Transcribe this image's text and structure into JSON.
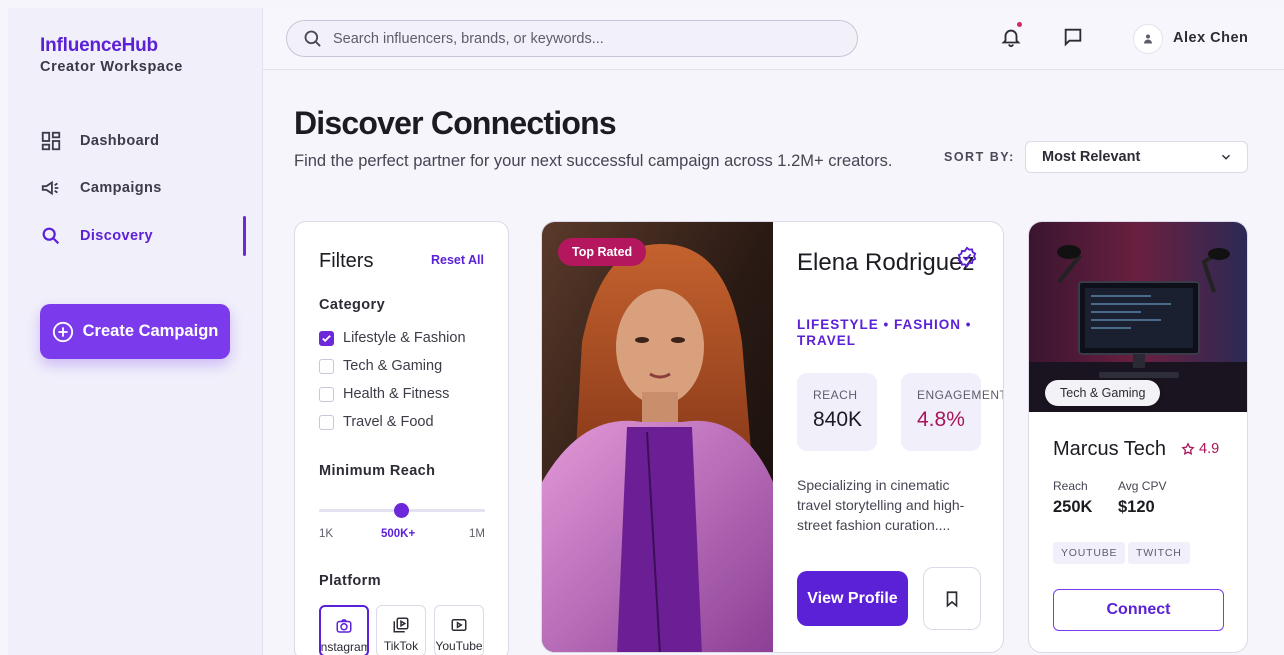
{
  "brand": {
    "name": "InfluenceHub",
    "subtitle": "Creator Workspace"
  },
  "nav": [
    {
      "label": "Dashboard",
      "icon": "dashboard-icon"
    },
    {
      "label": "Campaigns",
      "icon": "megaphone-icon"
    },
    {
      "label": "Discovery",
      "icon": "search-icon",
      "active": true
    }
  ],
  "create_button": "Create Campaign",
  "search": {
    "placeholder": "Search influencers, brands, or keywords..."
  },
  "user": {
    "name": "Alex Chen"
  },
  "page": {
    "title": "Discover Connections",
    "subtitle": "Find the perfect partner for your next successful campaign across 1.2M+ creators.",
    "sort_label": "SORT BY:",
    "sort_value": "Most Relevant"
  },
  "filters": {
    "title": "Filters",
    "reset": "Reset All",
    "category_label": "Category",
    "categories": [
      {
        "label": "Lifestyle & Fashion",
        "checked": true
      },
      {
        "label": "Tech & Gaming",
        "checked": false
      },
      {
        "label": "Health & Fitness",
        "checked": false
      },
      {
        "label": "Travel & Food",
        "checked": false
      }
    ],
    "reach_label": "Minimum Reach",
    "reach_min": "1K",
    "reach_value": "500K+",
    "reach_max": "1M",
    "platform_label": "Platform",
    "platforms": [
      {
        "label": "Instagram",
        "selected": true
      },
      {
        "label": "TikTok",
        "selected": false
      },
      {
        "label": "YouTube",
        "selected": false
      }
    ]
  },
  "featured": {
    "badge": "Top Rated",
    "name": "Elena Rodriguez",
    "tags": "LIFESTYLE • FASHION • TRAVEL",
    "reach_label": "REACH",
    "reach_value": "840K",
    "engagement_label": "ENGAGEMENT",
    "engagement_value": "4.8%",
    "description": "Specializing in cinematic travel storytelling and high-street fashion curation....",
    "view_button": "View Profile"
  },
  "secondary": {
    "tag": "Tech & Gaming",
    "name": "Marcus Tech",
    "rating": "4.9",
    "reach_label": "Reach",
    "reach_value": "250K",
    "cpv_label": "Avg CPV",
    "cpv_value": "$120",
    "chips": [
      "YOUTUBE",
      "TWITCH"
    ],
    "connect_button": "Connect"
  },
  "colors": {
    "accent": "#5b21d6",
    "primary_button": "#7c3aed",
    "pink": "#a8145a",
    "badge": "#b5175e"
  }
}
